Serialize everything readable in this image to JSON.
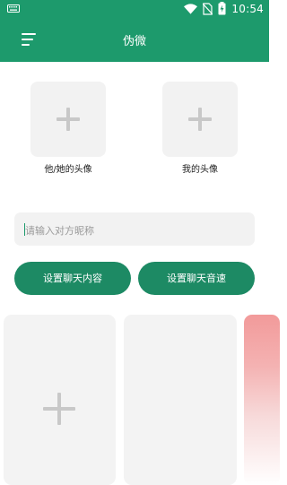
{
  "status_bar": {
    "time": "10:54",
    "icons": [
      "keyboard-icon",
      "wifi-icon",
      "sim-off-icon",
      "battery-charging-icon"
    ]
  },
  "app_bar": {
    "title": "伪微",
    "menu_icon": "menu-icon"
  },
  "avatars": {
    "other": {
      "label": "他/她的头像"
    },
    "mine": {
      "label": "我的头像"
    }
  },
  "name_input": {
    "value": "",
    "placeholder": "请输入对方昵称"
  },
  "buttons": {
    "chat_content": "设置聊天内容",
    "chat_sound": "设置聊天音速"
  },
  "colors": {
    "primary": "#1d9a6c",
    "button": "#1d8a64",
    "card_red": "#f29a9a"
  }
}
